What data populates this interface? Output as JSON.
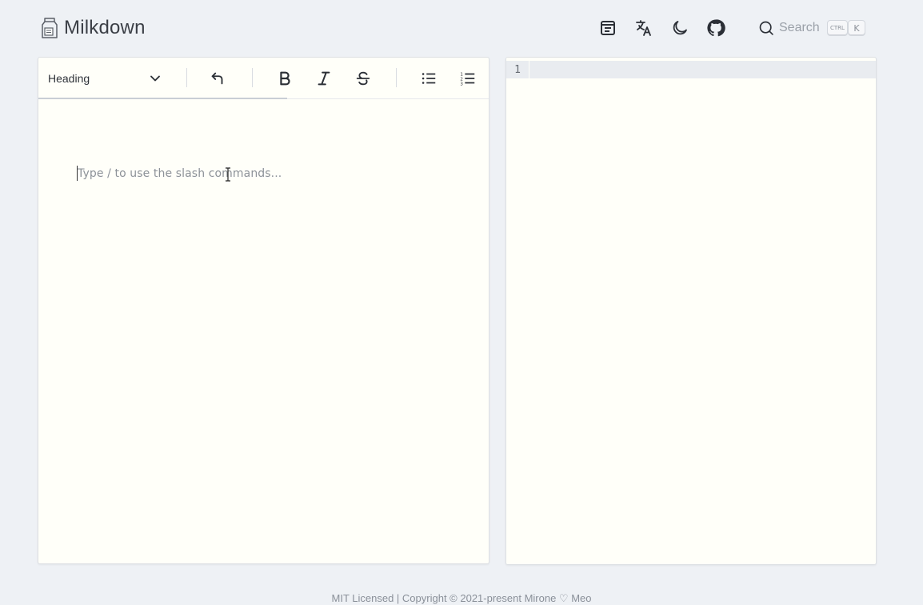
{
  "header": {
    "title": "Milkdown",
    "logo_icon": "milk-carton-icon",
    "icons": [
      "toc-icon",
      "translate-icon",
      "dark-mode-icon",
      "github-icon"
    ],
    "search": {
      "label": "Search",
      "shortcut_modifier": "CTRL",
      "shortcut_key": "K"
    }
  },
  "toolbar": {
    "heading_select": "Heading",
    "buttons": [
      "undo-icon",
      "bold-icon",
      "italic-icon",
      "strikethrough-icon",
      "bulleted-list-icon",
      "numbered-list-icon"
    ]
  },
  "editor": {
    "placeholder": "Type / to use the slash commands..."
  },
  "code": {
    "line_numbers": [
      "1"
    ]
  },
  "footer": {
    "text": "MIT Licensed | Copyright © 2021-present Mirone ♡ Meo"
  },
  "colors": {
    "background": "#eef1f5",
    "panel": "#fffff9",
    "active_line": "#e9ecf0"
  }
}
